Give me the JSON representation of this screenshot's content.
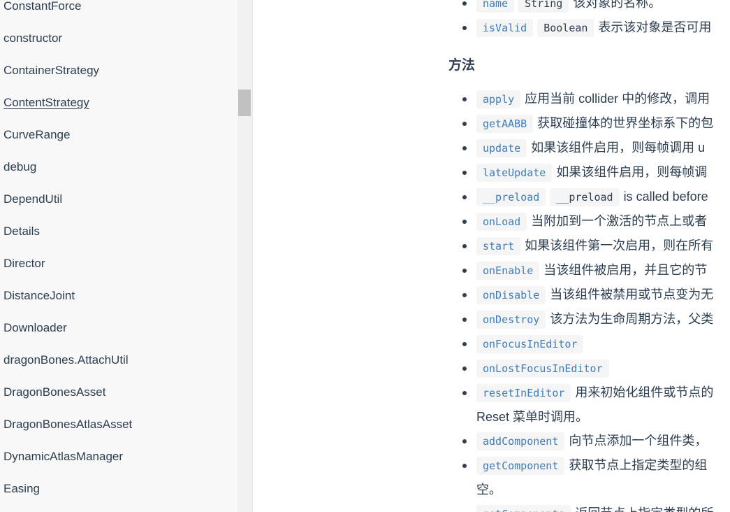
{
  "sidebar": {
    "items": [
      {
        "label": "ConstantForce",
        "active": false
      },
      {
        "label": "constructor",
        "active": false
      },
      {
        "label": "ContainerStrategy",
        "active": false
      },
      {
        "label": "ContentStrategy",
        "active": true
      },
      {
        "label": "CurveRange",
        "active": false
      },
      {
        "label": "debug",
        "active": false
      },
      {
        "label": "DependUtil",
        "active": false
      },
      {
        "label": "Details",
        "active": false
      },
      {
        "label": "Director",
        "active": false
      },
      {
        "label": "DistanceJoint",
        "active": false
      },
      {
        "label": "Downloader",
        "active": false
      },
      {
        "label": "dragonBones.AttachUtil",
        "active": false
      },
      {
        "label": "DragonBonesAsset",
        "active": false
      },
      {
        "label": "DragonBonesAtlasAsset",
        "active": false
      },
      {
        "label": "DynamicAtlasManager",
        "active": false
      },
      {
        "label": "Easing",
        "active": false
      }
    ]
  },
  "properties": [
    {
      "name": "name",
      "type": "String",
      "desc": "该对象的名称。"
    },
    {
      "name": "isValid",
      "type": "Boolean",
      "desc": "表示该对象是否可用"
    }
  ],
  "methods_heading": "方法",
  "methods": [
    {
      "name": "apply",
      "extra": "",
      "desc": "应用当前 collider 中的修改，调用",
      "cont": ""
    },
    {
      "name": "getAABB",
      "extra": "",
      "desc": "获取碰撞体的世界坐标系下的包",
      "cont": ""
    },
    {
      "name": "update",
      "extra": "",
      "desc": "如果该组件启用，则每帧调用 u",
      "cont": ""
    },
    {
      "name": "lateUpdate",
      "extra": "",
      "desc": "如果该组件启用，则每帧调",
      "cont": ""
    },
    {
      "name": "__preload",
      "extra": "__preload",
      "desc": "is called before",
      "cont": ""
    },
    {
      "name": "onLoad",
      "extra": "",
      "desc": "当附加到一个激活的节点上或者",
      "cont": ""
    },
    {
      "name": "start",
      "extra": "",
      "desc": "如果该组件第一次启用，则在所有",
      "cont": ""
    },
    {
      "name": "onEnable",
      "extra": "",
      "desc": "当该组件被启用，并且它的节",
      "cont": ""
    },
    {
      "name": "onDisable",
      "extra": "",
      "desc": "当该组件被禁用或节点变为无",
      "cont": ""
    },
    {
      "name": "onDestroy",
      "extra": "",
      "desc": "该方法为生命周期方法，父类",
      "cont": ""
    },
    {
      "name": "onFocusInEditor",
      "extra": "",
      "desc": "",
      "cont": ""
    },
    {
      "name": "onLostFocusInEditor",
      "extra": "",
      "desc": "",
      "cont": ""
    },
    {
      "name": "resetInEditor",
      "extra": "",
      "desc": "用来初始化组件或节点的",
      "cont": "Reset 菜单时调用。"
    },
    {
      "name": "addComponent",
      "extra": "",
      "desc": "向节点添加一个组件类，",
      "cont": ""
    },
    {
      "name": "getComponent",
      "extra": "",
      "desc": "获取节点上指定类型的组",
      "cont": "空。"
    },
    {
      "name": "getComponents",
      "extra": "",
      "desc": "返回节点上指定类型的所",
      "cont": ""
    }
  ],
  "colors": {
    "link": "#3e7dbb",
    "text": "#2c3e50",
    "sidebar_bg": "#f8f8f8",
    "code_bg": "#f5f5f5"
  }
}
